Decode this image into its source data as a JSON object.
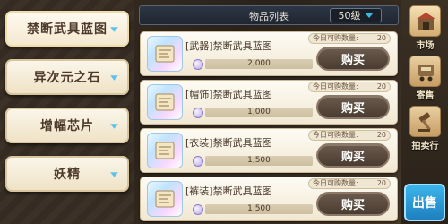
{
  "categories": [
    {
      "label": "禁断武具蓝图"
    },
    {
      "label": "异次元之石"
    },
    {
      "label": "增幅芯片"
    },
    {
      "label": "妖精"
    }
  ],
  "list": {
    "title": "物品列表",
    "level_filter": "50级"
  },
  "items": [
    {
      "name": "[武器]禁断武具蓝图",
      "quota_label": "今日可购数量:",
      "quota_count": "20",
      "price": "2,000",
      "buy_label": "购买"
    },
    {
      "name": "[帽饰]禁断武具蓝图",
      "quota_label": "今日可购数量:",
      "quota_count": "20",
      "price": "1,000",
      "buy_label": "购买"
    },
    {
      "name": "[衣装]禁断武具蓝图",
      "quota_label": "今日可购数量:",
      "quota_count": "20",
      "price": "1,500",
      "buy_label": "购买"
    },
    {
      "name": "[裤装]禁断武具蓝图",
      "quota_label": "今日可购数量:",
      "quota_count": "20",
      "price": "1,500",
      "buy_label": "购买"
    }
  ],
  "nav": [
    {
      "label": "市场",
      "icon": "market-stall-icon"
    },
    {
      "label": "寄售",
      "icon": "consign-cart-icon"
    },
    {
      "label": "拍卖行",
      "icon": "gavel-icon"
    }
  ],
  "sell_button": "出售",
  "colors": {
    "accent_blue": "#3db6e6",
    "button_brown": "#5a4a3e"
  }
}
